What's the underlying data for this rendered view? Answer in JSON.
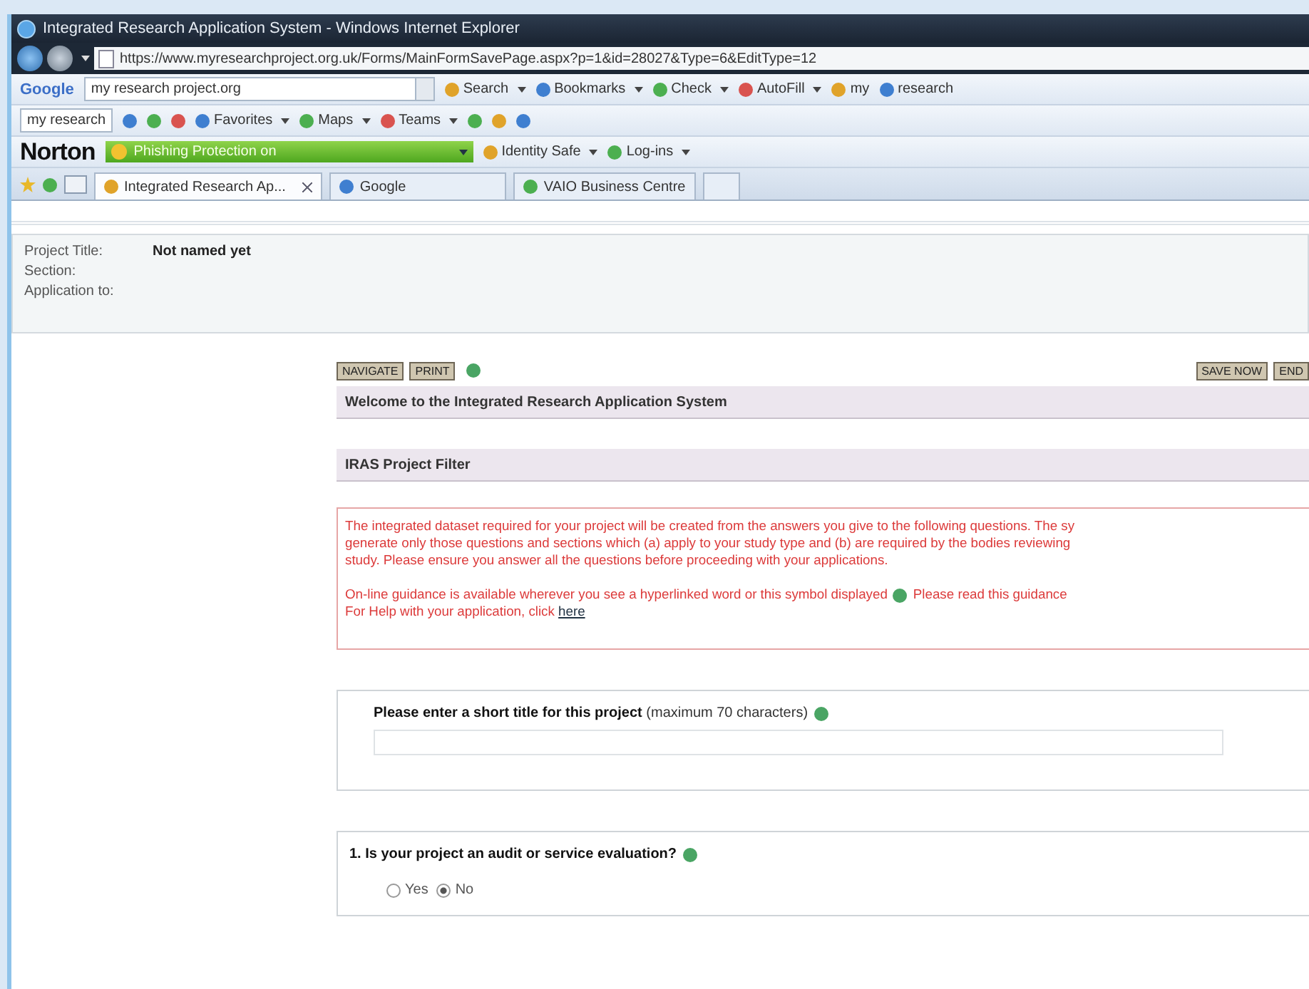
{
  "window": {
    "title": "Integrated Research Application System - Windows Internet Explorer"
  },
  "address_bar": {
    "url": "https://www.myresearchproject.org.uk/Forms/MainFormSavePage.aspx?p=1&id=28027&Type=6&EditType=12"
  },
  "google_toolbar": {
    "logo": "Google",
    "search_value": "my research project.org",
    "items": [
      {
        "label": "Search",
        "menu": true
      },
      {
        "label": "Bookmarks",
        "menu": true
      },
      {
        "label": "Check",
        "menu": true
      },
      {
        "label": "AutoFill",
        "menu": true
      },
      {
        "label": "my",
        "menu": false
      },
      {
        "label": "research",
        "menu": false
      }
    ]
  },
  "links_toolbar": {
    "search_value": "my research",
    "items": [
      {
        "label": "Favorites",
        "menu": true
      },
      {
        "label": "Maps",
        "menu": true
      },
      {
        "label": "Teams",
        "menu": true
      }
    ]
  },
  "norton_toolbar": {
    "logo": "Norton",
    "status": "Phishing Protection on",
    "items": [
      {
        "label": "Identity Safe",
        "menu": true
      },
      {
        "label": "Log-ins",
        "menu": true
      }
    ]
  },
  "tabs": [
    {
      "label": "Integrated Research Ap...",
      "selected": true
    },
    {
      "label": "Google",
      "selected": false
    },
    {
      "label": "VAIO Business Centre",
      "selected": false
    }
  ],
  "project_info": [
    {
      "label": "Project Title:",
      "value": "Not named yet"
    },
    {
      "label": "Section:"
    },
    {
      "label": "Application to:"
    }
  ],
  "left_buttons": [
    "NAVIGATE",
    "PRINT"
  ],
  "right_buttons": [
    "SAVE NOW",
    "END"
  ],
  "welcome_heading": "Welcome to the Integrated Research Application System",
  "filter_heading": "IRAS Project Filter",
  "intro": {
    "paragraph": "The integrated dataset required for your project will be created from the answers you give to the following questions. The sy\ngenerate only those questions and sections which (a) apply to your study type and (b) are required by the bodies reviewing\nstudy. Please ensure you answer all the questions before proceeding with your applications.",
    "guidance_before": "On-line guidance is available wherever you see a hyperlinked word or this symbol displayed",
    "guidance_after": "Please read this guidance",
    "help": "For Help with your application, click",
    "help_link": "here"
  },
  "title_question": {
    "label": "Please enter a short title for this project",
    "hint": "(maximum 70 characters)"
  },
  "question_1": {
    "label": "1. Is your project an audit or service evaluation?",
    "options": [
      {
        "label": "Yes",
        "selected": false
      },
      {
        "label": "No",
        "selected": true
      }
    ]
  }
}
